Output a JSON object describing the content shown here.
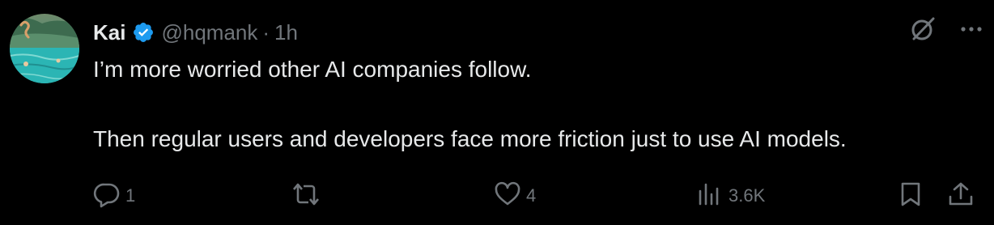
{
  "author": {
    "display_name": "Kai",
    "handle": "@hqmank",
    "separator": "·",
    "time": "1h",
    "verified_color": "#1d9bf0"
  },
  "tweet": {
    "lines": [
      "I’m more worried other AI companies follow.",
      "Then regular users and developers face more friction just to use AI models."
    ]
  },
  "actions": {
    "reply_count": "1",
    "repost_count": "",
    "like_count": "4",
    "views_count": "3.6K"
  },
  "icons": {
    "top_right": [
      "grok-icon",
      "more-icon"
    ],
    "action_bar": [
      "reply-icon",
      "repost-icon",
      "like-icon",
      "views-icon",
      "bookmark-icon",
      "share-icon"
    ]
  },
  "colors": {
    "background": "#000000",
    "primary_text": "#e7e9ea",
    "secondary_text": "#71767b",
    "verified": "#1d9bf0"
  }
}
